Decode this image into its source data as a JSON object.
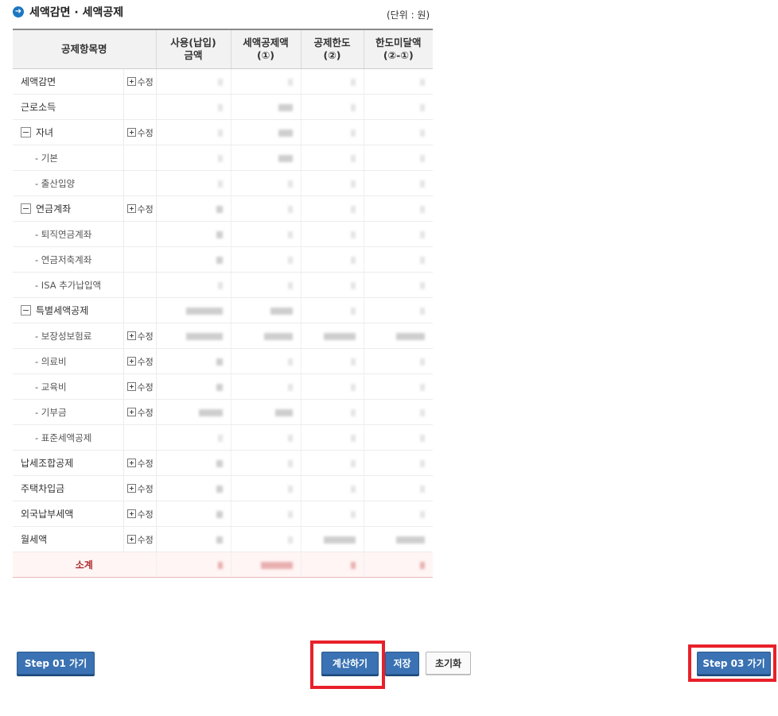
{
  "page": {
    "title": "세액감면 · 세액공제",
    "unit": "(단위 : 원)"
  },
  "table": {
    "headers": {
      "name": "공제항목명",
      "paid": [
        "사용(납입)",
        "금액"
      ],
      "deduction": [
        "세액공제액",
        "(①)"
      ],
      "limit": [
        "공제한도",
        "(②)"
      ],
      "shortfall": [
        "한도미달액",
        "(②-①)"
      ]
    },
    "edit_label": "수정",
    "rows": [
      {
        "label": "세액감면",
        "level": 0,
        "collapsible": false,
        "edit": true
      },
      {
        "label": "근로소득",
        "level": 0,
        "collapsible": false,
        "edit": false
      },
      {
        "label": "자녀",
        "level": 0,
        "collapsible": true,
        "edit": true
      },
      {
        "label": "- 기본",
        "level": 1,
        "collapsible": false,
        "edit": false
      },
      {
        "label": "- 출산입양",
        "level": 1,
        "collapsible": false,
        "edit": false
      },
      {
        "label": "연금계좌",
        "level": 0,
        "collapsible": true,
        "edit": true
      },
      {
        "label": "- 퇴직연금계좌",
        "level": 1,
        "collapsible": false,
        "edit": false
      },
      {
        "label": "- 연금저축계좌",
        "level": 1,
        "collapsible": false,
        "edit": false
      },
      {
        "label": "- ISA 추가납입액",
        "level": 1,
        "collapsible": false,
        "edit": false
      },
      {
        "label": "특별세액공제",
        "level": 0,
        "collapsible": true,
        "edit": false
      },
      {
        "label": "- 보장성보험료",
        "level": 1,
        "collapsible": false,
        "edit": true
      },
      {
        "label": "- 의료비",
        "level": 1,
        "collapsible": false,
        "edit": true
      },
      {
        "label": "- 교육비",
        "level": 1,
        "collapsible": false,
        "edit": true
      },
      {
        "label": "- 기부금",
        "level": 1,
        "collapsible": false,
        "edit": true
      },
      {
        "label": "- 표준세액공제",
        "level": 1,
        "collapsible": false,
        "edit": false
      },
      {
        "label": "납세조합공제",
        "level": 0,
        "collapsible": false,
        "edit": true
      },
      {
        "label": "주택차입금",
        "level": 0,
        "collapsible": false,
        "edit": true
      },
      {
        "label": "외국납부세액",
        "level": 0,
        "collapsible": false,
        "edit": true
      },
      {
        "label": "월세액",
        "level": 0,
        "collapsible": false,
        "edit": true
      }
    ],
    "subtotal_label": "소계"
  },
  "buttons": {
    "step01": "Step 01 가기",
    "calculate": "계산하기",
    "save": "저장",
    "reset": "초기화",
    "step03": "Step 03 가기"
  },
  "colors": {
    "accent": "#3a72b3",
    "highlight": "#e8202a",
    "subtotal": "#b02a2a"
  }
}
